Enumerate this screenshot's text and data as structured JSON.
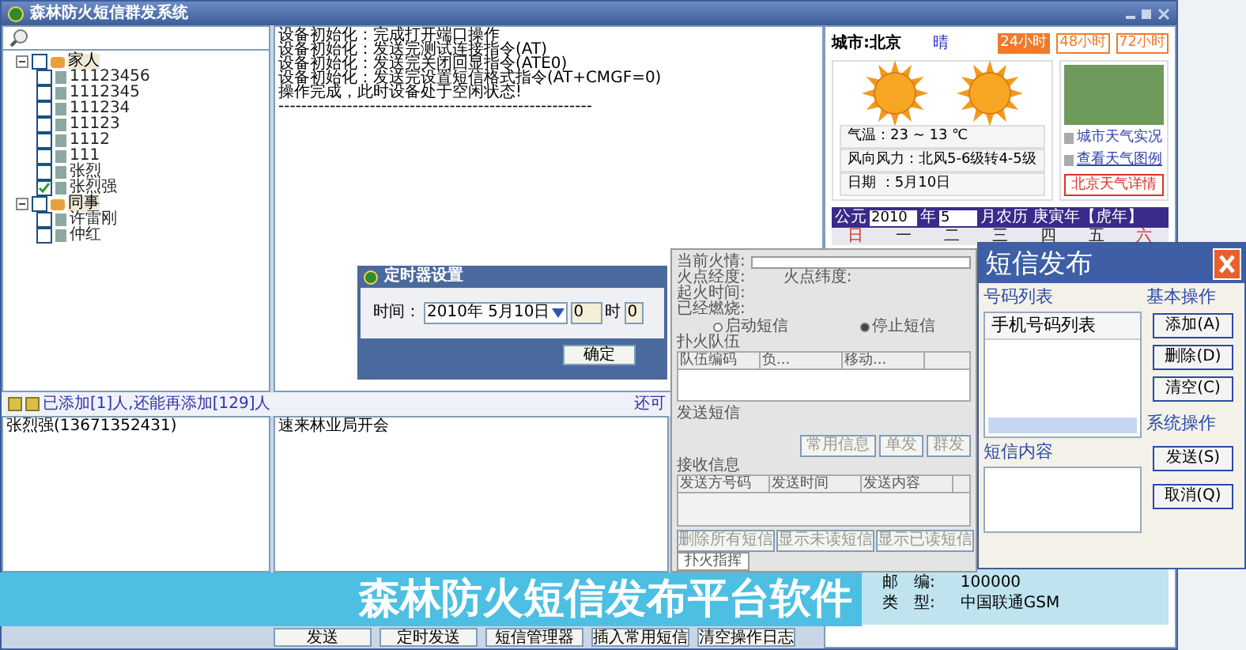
{
  "main_window": {
    "title": "森林防火短信群发系统",
    "tree": [
      {
        "label": "家人",
        "checked": false,
        "expanded": true,
        "children": [
          {
            "label": "11123456",
            "checked": false
          },
          {
            "label": "1112345",
            "checked": false
          },
          {
            "label": "111234",
            "checked": false
          },
          {
            "label": "11123",
            "checked": false
          },
          {
            "label": "1112",
            "checked": false
          },
          {
            "label": "111",
            "checked": false
          },
          {
            "label": "张烈",
            "checked": false
          },
          {
            "label": "张烈强",
            "checked": true
          }
        ]
      },
      {
        "label": "同事",
        "checked": false,
        "expanded": true,
        "children": [
          {
            "label": "许雷刚",
            "checked": false
          },
          {
            "label": "仲红",
            "checked": false
          }
        ]
      }
    ],
    "log_lines": [
      "设备初始化：完成打开端口操作",
      "设备初始化：发送完测试连接指令(AT)",
      "设备初始化：发送完关闭回显指令(ATE0)",
      "设备初始化：发送完设置短信格式指令(AT+CMGF=0)",
      "操作完成，此时设备处于空闲状态!",
      "-------------------------------------------------------"
    ],
    "status_text": "已添加[1]人,还能再添加[129]人",
    "status_more": "还可",
    "recipients": [
      "张烈强(13671352431)"
    ],
    "message": "速来林业局开会",
    "buttons": [
      "发送",
      "定时发送",
      "短信管理器",
      "插入常用短信",
      "清空操作日志"
    ]
  },
  "weather": {
    "city": "城市:北京",
    "condition": "晴",
    "ranges": [
      {
        "label": "24小时",
        "selected": true
      },
      {
        "label": "48小时",
        "selected": false
      },
      {
        "label": "72小时",
        "selected": false
      }
    ],
    "info": [
      "气温：23 ~ 13 ℃",
      "风向风力：北风5-6级转4-5级",
      "日期 ：5月10日"
    ],
    "links": [
      "城市天气实况",
      "查看天气图例"
    ],
    "detail_button": "北京天气详情",
    "calendar": {
      "era": "公元",
      "year": "2010",
      "year_unit": "年",
      "month": "5",
      "month_rest": "月农历 庚寅年【虎年】",
      "weekdays": [
        "日",
        "一",
        "二",
        "三",
        "四",
        "五",
        "六"
      ]
    },
    "postal": [
      {
        "label": "邮　编:",
        "value": "100000"
      },
      {
        "label": "类　型:",
        "value": "中国联通GSM"
      }
    ]
  },
  "timer_dialog": {
    "title": "定时器设置",
    "time_label": "时间：",
    "date": "2010年 5月10日",
    "hour": "0",
    "hour_unit": "时",
    "minute": "0",
    "ok": "确定"
  },
  "fire_window": {
    "fields": [
      "当前火情:",
      "火点经度:",
      "火点纬度:",
      "起火时间:",
      "已经燃烧:"
    ],
    "radios": [
      {
        "label": "启动短信",
        "selected": false
      },
      {
        "label": "停止短信",
        "selected": true
      }
    ],
    "team_title": "扑火队伍",
    "team_columns": [
      "队伍编码",
      "负...",
      "移动..."
    ],
    "send_title": "发送短信",
    "send_buttons": [
      "常用信息",
      "单发",
      "群发"
    ],
    "receive_title": "接收信息",
    "receive_columns": [
      "发送方号码",
      "发送时间",
      "发送内容"
    ],
    "receive_buttons": [
      "删除所有短信",
      "显示未读短信",
      "显示已读短信"
    ],
    "tab": "扑火指挥"
  },
  "sms_window": {
    "title": "短信发布",
    "list_group": "号码列表",
    "list_header": "手机号码列表",
    "content_group": "短信内容",
    "basic_group": "基本操作",
    "basic_buttons": [
      "添加(A)",
      "删除(D)",
      "清空(C)"
    ],
    "system_group": "系统操作",
    "system_buttons": [
      "发送(S)",
      "取消(Q)"
    ]
  },
  "banner": "森林防火短信发布平台软件"
}
